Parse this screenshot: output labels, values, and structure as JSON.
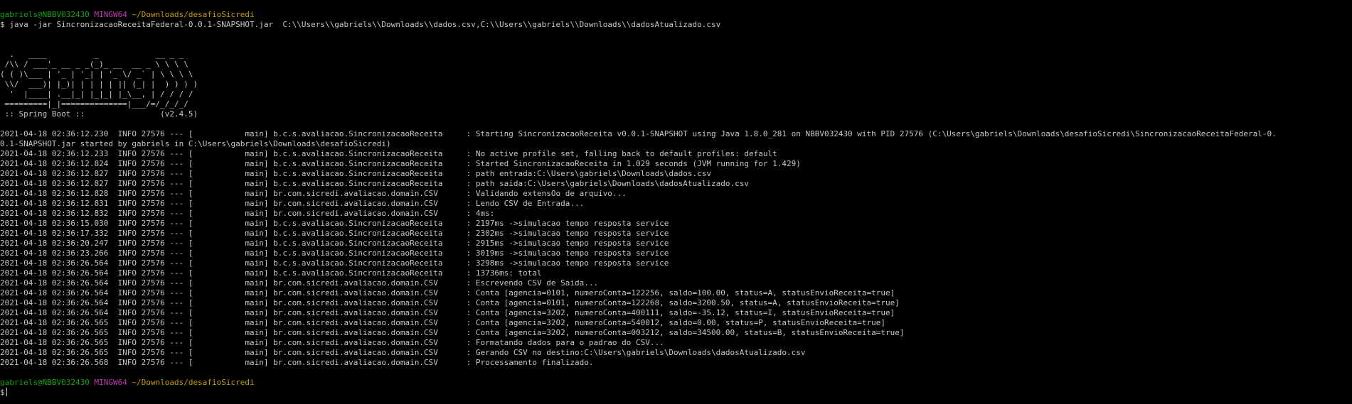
{
  "prompt": {
    "user_host": "gabriels@NBBV032430",
    "msystem": "MINGW64",
    "cwd": "~/Downloads/desafioSicredi",
    "symbol": "$"
  },
  "command": "java -jar SincronizacaoReceitaFederal-0.0.1-SNAPSHOT.jar  C:\\\\Users\\\\gabriels\\\\Downloads\\\\dados.csv,C:\\\\Users\\\\gabriels\\\\Downloads\\\\dadosAtualizado.csv",
  "banner": [
    "  .   ____          _            __ _ _",
    " /\\\\ / ___'_ __ _ _(_)_ __  __ _ \\ \\ \\ \\",
    "( ( )\\___ | '_ | '_| | '_ \\/ _` | \\ \\ \\ \\",
    " \\\\/  ___)| |_)| | | | | || (_| |  ) ) ) )",
    "  '  |____| .__|_| |_|_| |_\\__, | / / / /",
    " =========|_|==============|___/=/_/_/_/",
    " :: Spring Boot ::                (v2.4.5)"
  ],
  "log_lines": [
    "2021-04-18 02:36:12.230  INFO 27576 --- [           main] b.c.s.avaliacao.SincronizacaoReceita     : Starting SincronizacaoReceita v0.0.1-SNAPSHOT using Java 1.8.0_281 on NBBV032430 with PID 27576 (C:\\Users\\gabriels\\Downloads\\desafioSicredi\\SincronizacaoReceitaFederal-0.",
    "0.1-SNAPSHOT.jar started by gabriels in C:\\Users\\gabriels\\Downloads\\desafioSicredi)",
    "2021-04-18 02:36:12.233  INFO 27576 --- [           main] b.c.s.avaliacao.SincronizacaoReceita     : No active profile set, falling back to default profiles: default",
    "2021-04-18 02:36:12.824  INFO 27576 --- [           main] b.c.s.avaliacao.SincronizacaoReceita     : Started SincronizacaoReceita in 1.029 seconds (JVM running for 1.429)",
    "2021-04-18 02:36:12.827  INFO 27576 --- [           main] b.c.s.avaliacao.SincronizacaoReceita     : path entrada:C:\\Users\\gabriels\\Downloads\\dados.csv",
    "2021-04-18 02:36:12.827  INFO 27576 --- [           main] b.c.s.avaliacao.SincronizacaoReceita     : path saida:C:\\Users\\gabriels\\Downloads\\dadosAtualizado.csv",
    "2021-04-18 02:36:12.828  INFO 27576 --- [           main] br.com.sicredi.avaliacao.domain.CSV      : Validando extensOo de arquivo...",
    "2021-04-18 02:36:12.831  INFO 27576 --- [           main] br.com.sicredi.avaliacao.domain.CSV      : Lendo CSV de Entrada...",
    "2021-04-18 02:36:12.832  INFO 27576 --- [           main] br.com.sicredi.avaliacao.domain.CSV      : 4ms:",
    "2021-04-18 02:36:15.030  INFO 27576 --- [           main] b.c.s.avaliacao.SincronizacaoReceita     : 2197ms ->simulacao tempo resposta service",
    "2021-04-18 02:36:17.332  INFO 27576 --- [           main] b.c.s.avaliacao.SincronizacaoReceita     : 2302ms ->simulacao tempo resposta service",
    "2021-04-18 02:36:20.247  INFO 27576 --- [           main] b.c.s.avaliacao.SincronizacaoReceita     : 2915ms ->simulacao tempo resposta service",
    "2021-04-18 02:36:23.266  INFO 27576 --- [           main] b.c.s.avaliacao.SincronizacaoReceita     : 3019ms ->simulacao tempo resposta service",
    "2021-04-18 02:36:26.564  INFO 27576 --- [           main] b.c.s.avaliacao.SincronizacaoReceita     : 3298ms ->simulacao tempo resposta service",
    "2021-04-18 02:36:26.564  INFO 27576 --- [           main] b.c.s.avaliacao.SincronizacaoReceita     : 13736ms: total",
    "2021-04-18 02:36:26.564  INFO 27576 --- [           main] br.com.sicredi.avaliacao.domain.CSV      : Escrevendo CSV de Saida...",
    "2021-04-18 02:36:26.564  INFO 27576 --- [           main] br.com.sicredi.avaliacao.domain.CSV      : Conta [agencia=0101, numeroConta=122256, saldo=100.00, status=A, statusEnvioReceita=true]",
    "2021-04-18 02:36:26.564  INFO 27576 --- [           main] br.com.sicredi.avaliacao.domain.CSV      : Conta [agencia=0101, numeroConta=122268, saldo=3200.50, status=A, statusEnvioReceita=true]",
    "2021-04-18 02:36:26.564  INFO 27576 --- [           main] br.com.sicredi.avaliacao.domain.CSV      : Conta [agencia=3202, numeroConta=400111, saldo=-35.12, status=I, statusEnvioReceita=true]",
    "2021-04-18 02:36:26.565  INFO 27576 --- [           main] br.com.sicredi.avaliacao.domain.CSV      : Conta [agencia=3202, numeroConta=540012, saldo=0.00, status=P, statusEnvioReceita=true]",
    "2021-04-18 02:36:26.565  INFO 27576 --- [           main] br.com.sicredi.avaliacao.domain.CSV      : Conta [agencia=3202, numeroConta=003212, saldo=34500.00, status=B, statusEnvioReceita=true]",
    "2021-04-18 02:36:26.565  INFO 27576 --- [           main] br.com.sicredi.avaliacao.domain.CSV      : Formatando dados para o padrao do CSV...",
    "2021-04-18 02:36:26.565  INFO 27576 --- [           main] br.com.sicredi.avaliacao.domain.CSV      : Gerando CSV no destino:C:\\Users\\gabriels\\Downloads\\dadosAtualizado.csv",
    "2021-04-18 02:36:26.568  INFO 27576 --- [           main] br.com.sicredi.avaliacao.domain.CSV      : Processamento finalizado."
  ],
  "colors": {
    "background": "#000000",
    "text": "#c7c7c7",
    "user_host": "#13a10e",
    "msystem": "#c239b3",
    "cwd": "#c19c00"
  }
}
